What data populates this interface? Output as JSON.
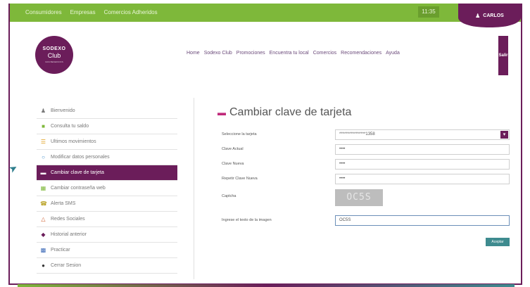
{
  "topbar": {
    "links": [
      "Consumidores",
      "Empresas",
      "Comercios Adheridos"
    ],
    "clock": "11:35",
    "user": "CARLOS"
  },
  "logo": {
    "line1": "SODEXO",
    "line2": "Club",
    "line3": "MAS BENEFICIOS"
  },
  "nav": {
    "items": [
      "Home",
      "Sodexo Club",
      "Promociones",
      "Encuentra tu local",
      "Comercios",
      "Recomendaciones",
      "Ayuda"
    ],
    "logout": "Salir"
  },
  "sidebar": {
    "items": [
      {
        "label": "Bienvenido",
        "icon": "user-icon"
      },
      {
        "label": "Consulta tu saldo",
        "icon": "wallet-icon"
      },
      {
        "label": "Ultimos movimientos",
        "icon": "list-icon"
      },
      {
        "label": "Modificar datos personales",
        "icon": "person-edit-icon"
      },
      {
        "label": "Cambiar clave de tarjeta",
        "icon": "card-icon"
      },
      {
        "label": "Cambiar contraseña web",
        "icon": "key-icon"
      },
      {
        "label": "Alerta SMS",
        "icon": "phone-icon"
      },
      {
        "label": "Redes Sociales",
        "icon": "share-icon"
      },
      {
        "label": "Historial anterior",
        "icon": "history-icon"
      },
      {
        "label": "Practicar",
        "icon": "practice-icon"
      },
      {
        "label": "Cerrar Sesion",
        "icon": "power-icon"
      }
    ]
  },
  "form": {
    "title": "Cambiar clave de tarjeta",
    "card_label": "Seleccione la tarjeta",
    "card_value": "****************1358",
    "current_label": "Clave Actual",
    "current_value": "••••",
    "new_label": "Clave Nueva",
    "new_value": "••••",
    "repeat_label": "Repetir Clave Nueva",
    "repeat_value": "••••",
    "captcha_label": "Captcha",
    "captcha_text": "OC5S",
    "captcha_input_label": "Ingrese el texto de la imagen",
    "captcha_input_value": "OC5S",
    "accept_label": "Aceptar"
  },
  "colors": {
    "brand": "#6b1d5a",
    "green": "#7eb83a",
    "accent": "#3e8b8f"
  }
}
